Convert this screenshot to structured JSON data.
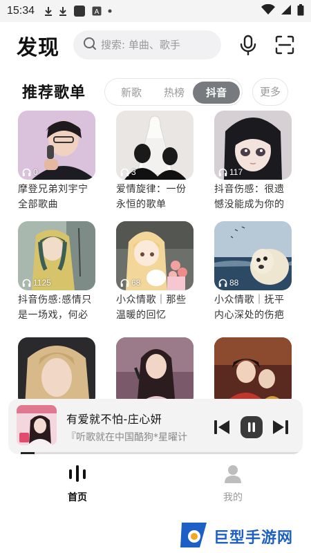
{
  "status_bar": {
    "time": "15:34",
    "icons": [
      "download-icon",
      "download-icon",
      "app-square-icon",
      "a-box-icon",
      "dot-icon"
    ],
    "right_icons": [
      "wifi-icon",
      "signal-icon",
      "battery-icon"
    ]
  },
  "header": {
    "title": "发现",
    "search_placeholder": "搜索: 单曲、歌手",
    "mic_icon": "microphone-icon",
    "scan_icon": "scan-icon"
  },
  "section": {
    "title": "推荐歌单",
    "tabs": [
      {
        "label": "新歌",
        "active": false
      },
      {
        "label": "热榜",
        "active": false
      },
      {
        "label": "抖音",
        "active": true
      }
    ],
    "more_label": "更多"
  },
  "playlists": [
    {
      "count": "0",
      "title": "摩登兄弟刘宇宁全部歌曲"
    },
    {
      "count": "3",
      "title": "爱情旋律：一份永恒的歌单"
    },
    {
      "count": "117",
      "title": "抖音伤感：很遗憾没能成为你的"
    },
    {
      "count": "1125",
      "title": "抖音伤感:感情只是一场戏，何必"
    },
    {
      "count": "68",
      "title": "小众情歌｜那些温暖的回忆"
    },
    {
      "count": "88",
      "title": "小众情歌｜抚平内心深处的伤疤"
    },
    {
      "count": "",
      "title": ""
    },
    {
      "count": "",
      "title": ""
    },
    {
      "count": "",
      "title": ""
    }
  ],
  "player": {
    "title": "有爱就不怕-庄心妍",
    "subtitle": "『听歌就在中国酷狗*星曜计",
    "progress": 0.05
  },
  "nav": {
    "home_label": "首页",
    "mine_label": "我的"
  },
  "watermark": {
    "text": "巨型手游网"
  },
  "colors": {
    "accent": "#777b80",
    "active_text": "#111111",
    "inactive_text": "#999999",
    "watermark_blue": "#1d5fc4"
  }
}
